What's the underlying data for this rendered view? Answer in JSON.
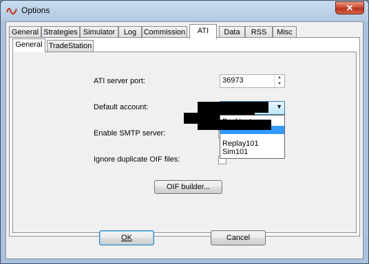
{
  "window": {
    "title": "Options",
    "close_label": "✕"
  },
  "tabs": [
    "General",
    "Strategies",
    "Simulator",
    "Log",
    "Commission",
    "ATI",
    "Data",
    "RSS",
    "Misc"
  ],
  "active_tab": "ATI",
  "subtabs": [
    "General",
    "TradeStation"
  ],
  "active_subtab": "General",
  "settings": {
    "server_port_label": "ATI server port:",
    "server_port_value": "36973",
    "default_account_label": "Default account:",
    "enable_smtp_label": "Enable SMTP server:",
    "ignore_duplicate_label": "Ignore duplicate OIF files:",
    "oif_builder_label": "OIF builder..."
  },
  "dropdown": {
    "options": [
      "Backtest",
      "",
      "Replay101",
      "Sim101"
    ],
    "highlighted_index": 1
  },
  "footer": {
    "ok_label": "OK",
    "cancel_label": "Cancel"
  },
  "colors": {
    "accent": "#3399ff",
    "redaction": "#000000",
    "close_button": "#c9452d"
  }
}
